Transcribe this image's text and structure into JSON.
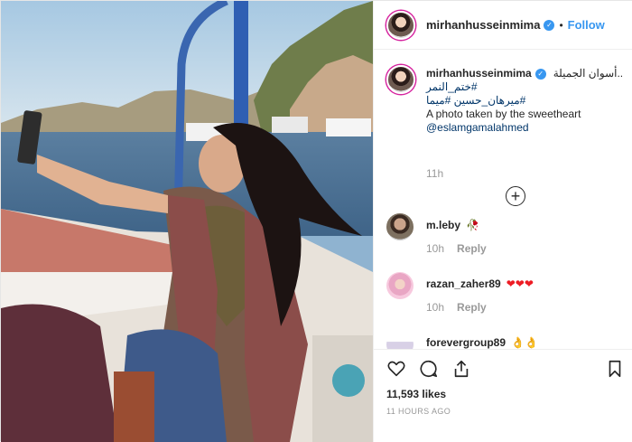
{
  "header": {
    "username": "mirhanhusseinmima",
    "separator": "•",
    "follow_label": "Follow"
  },
  "caption": {
    "username": "mirhanhusseinmima",
    "line1": "..أسوان الجميلة",
    "line2": "#ختم_النمر",
    "line3": "#ميرهان_حسين #ميما",
    "line4": "A photo taken by the sweetheart",
    "line5": "@eslamgamalahmed",
    "time": "11h",
    "load_more": "+"
  },
  "comments": [
    {
      "username": "m.leby",
      "text": "🥀",
      "time": "10h",
      "reply": "Reply"
    },
    {
      "username": "razan_zaher89",
      "text": "❤❤❤",
      "time": "10h",
      "reply": "Reply"
    },
    {
      "username": "forevergroup89",
      "text": "👌👌",
      "time": "",
      "reply": ""
    }
  ],
  "stats": {
    "likes": "11,593 likes",
    "posted_ago": "11 HOURS AGO"
  },
  "icons": [
    "heart-icon",
    "comment-icon",
    "share-icon",
    "bookmark-icon",
    "verified-icon",
    "plus-circle-icon"
  ],
  "colors": {
    "accent": "#3897f0",
    "heart": "#ed1c24",
    "muted": "#999999",
    "link": "#003569"
  }
}
